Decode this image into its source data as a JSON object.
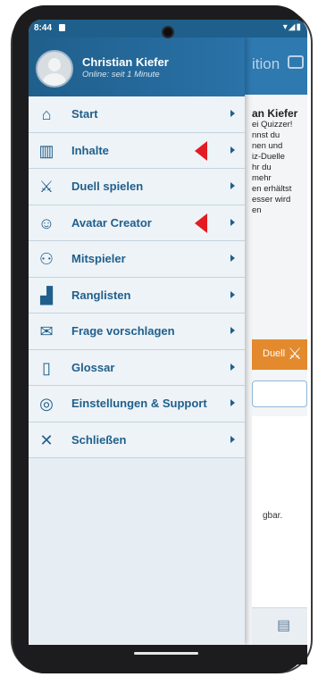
{
  "status_bar": {
    "time": "8:44",
    "right_icons": "▾◢▮"
  },
  "background_app": {
    "header_title": "ition",
    "card_title": "an Kiefer",
    "card_text": "ei Quizzer!\nnnst du\nnen und\niz-Duelle\nhr du\nmehr\nen erhältst\nesser wird\nen",
    "duel_button": "Duell",
    "availability_text": "gbar."
  },
  "drawer": {
    "user_name": "Christian Kiefer",
    "user_status": "Online: seit 1 Minute",
    "items": [
      {
        "label": "Start",
        "icon": "home-icon",
        "marked": false
      },
      {
        "label": "Inhalte",
        "icon": "content-icon",
        "marked": true
      },
      {
        "label": "Duell spielen",
        "icon": "crossed-swords-icon",
        "marked": false
      },
      {
        "label": "Avatar Creator",
        "icon": "avatar-face-icon",
        "marked": true
      },
      {
        "label": "Mitspieler",
        "icon": "players-icon",
        "marked": false
      },
      {
        "label": "Ranglisten",
        "icon": "podium-icon",
        "marked": false
      },
      {
        "label": "Frage vorschlagen",
        "icon": "envelope-icon",
        "marked": false
      },
      {
        "label": "Glossar",
        "icon": "book-icon",
        "marked": false
      },
      {
        "label": "Einstellungen & Support",
        "icon": "lifebuoy-icon",
        "marked": false
      },
      {
        "label": "Schließen",
        "icon": "close-icon",
        "marked": false
      }
    ]
  },
  "colors": {
    "primary": "#1f5f8c",
    "accent": "#e38a2e",
    "marker": "#e31b23"
  }
}
